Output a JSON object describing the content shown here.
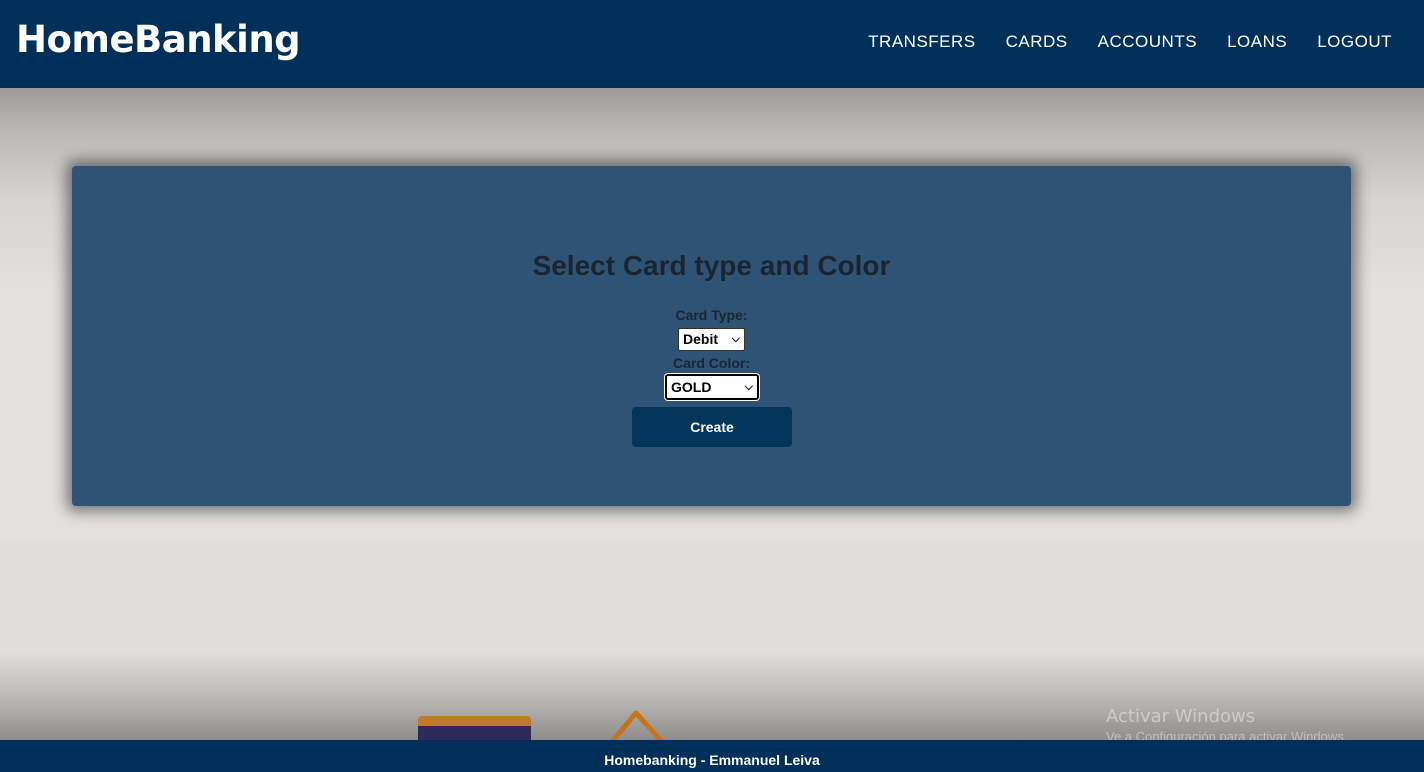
{
  "header": {
    "brand": "HomeBanking",
    "nav": [
      "TRANSFERS",
      "CARDS",
      "ACCOUNTS",
      "LOANS",
      "LOGOUT"
    ]
  },
  "form": {
    "title": "Select Card type and Color",
    "card_type_label": "Card Type:",
    "card_type_value": "Debit",
    "card_color_label": "Card Color:",
    "card_color_value": "GOLD",
    "create_label": "Create"
  },
  "watermark": {
    "title": "Activar Windows",
    "subtitle": "Ve a Configuración para activar Windows."
  },
  "footer": {
    "text": "Homebanking - Emmanuel Leiva"
  },
  "colors": {
    "navbar": "#00305a",
    "panel": "#2f5375",
    "button": "#023559",
    "background": "#e2e1df"
  },
  "icons": {
    "chevron": "chevron-down-icon",
    "card_illustration": "credit-card-icon",
    "bag_illustration": "shopping-bag-icon"
  }
}
